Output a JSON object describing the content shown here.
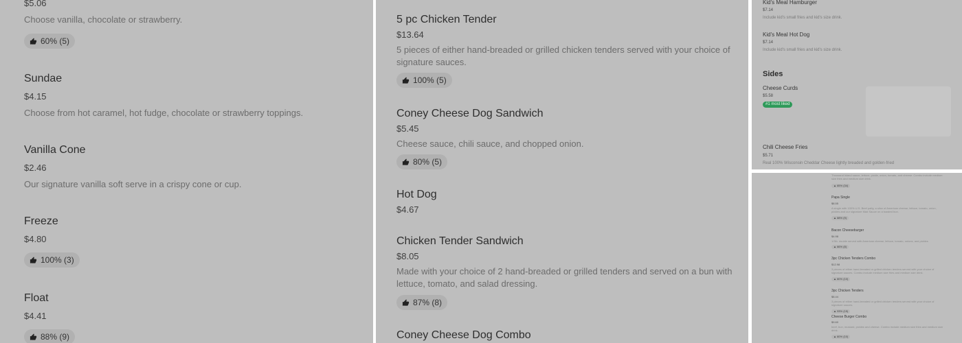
{
  "col1": {
    "top": {
      "price": "$5.06",
      "desc": "Choose vanilla, chocolate or strawberry.",
      "rating": "60% (5)"
    },
    "sundae": {
      "name": "Sundae",
      "price": "$4.15",
      "desc": "Choose from hot caramel, hot fudge, chocolate or strawberry toppings."
    },
    "cone": {
      "name": "Vanilla Cone",
      "price": "$2.46",
      "desc": "Our signature vanilla soft serve in a crispy cone or cup."
    },
    "freeze": {
      "name": "Freeze",
      "price": "$4.80",
      "rating": "100% (3)"
    },
    "float": {
      "name": "Float",
      "price": "$4.41",
      "rating": "88% (9)"
    }
  },
  "col2": {
    "tender5": {
      "name": "5 pc Chicken Tender",
      "price": "$13.64",
      "desc1": "5 pieces of either hand-breaded or grilled chicken tenders served with your choice of",
      "desc2": "signature sauces.",
      "rating": "100% (5)"
    },
    "coney": {
      "name": "Coney Cheese Dog Sandwich",
      "price": "$5.45",
      "desc": "Cheese sauce, chili sauce, and chopped onion.",
      "rating": "80% (5)"
    },
    "hotdog": {
      "name": "Hot Dog",
      "price": "$4.67"
    },
    "tendersand": {
      "name": "Chicken Tender Sandwich",
      "price": "$8.05",
      "desc1": "Made with your choice of 2 hand-breaded or grilled tenders and served on a bun with",
      "desc2": "lettuce, tomato, and salad dressing.",
      "rating": "87% (8)"
    },
    "coneycombo": {
      "name": "Coney Cheese Dog Combo"
    }
  },
  "col3": {
    "kidsburger": {
      "name": "Kid's Meal Hamburger",
      "price": "$7.14",
      "desc": "Include kid's small fries and kid's size drink."
    },
    "kidshotdog": {
      "name": "Kid's Meal Hot Dog",
      "price": "$7.14",
      "desc": "Include kid's small fries and kid's size drink."
    },
    "sides_heading": "Sides",
    "curds": {
      "name": "Cheese Curds",
      "price": "$5.58",
      "tag": "#1 most liked"
    },
    "fries": {
      "name": "Chili Cheese Fries",
      "price": "$5.71",
      "desc": "Real 100% Wisconsin Cheddar Cheese lightly breaded and golden-fried"
    }
  },
  "col4": {
    "frag": {
      "desc": "Thousand Island sauce, lettuce, pickle, onion, tomato, and cheese. Combo include medium",
      "desc2": "size fries and medium size drink.",
      "rating": "85% (34)"
    },
    "papa": {
      "name": "Papa Single",
      "price": "$8.55",
      "desc": "A single with 100% U.S. Beef patty, a slice of American cheese, lettuce, tomato, onion,",
      "desc2": "pickles and our signature Mad Sauce on a toasted bun.",
      "rating": "88% (9)"
    },
    "bacon": {
      "name": "Bacon Cheeseburger",
      "price": "$4.98",
      "desc": "1/3lb. double served with American cheese, lettuce, tomato, onions, and pickles",
      "rating": "86% (8)"
    },
    "combo3": {
      "name": "3pc Chicken Tenders Combo",
      "price": "$12.98",
      "desc": "3 pieces of either hand-breaded or grilled chicken tenders served with your choice of",
      "desc2": "signature sauces. Combo include medium size fries and medium size drink.",
      "rating": "80% (10)"
    },
    "tenders3": {
      "name": "3pc Chicken Tenders",
      "price": "$8.44",
      "desc": "3 pieces of either hand-breaded or grilled chicken tenders served with your choice of",
      "desc2": "signature sauces.",
      "rating": "93% (15)"
    },
    "cbcombo": {
      "name": "Cheese Burger Combo",
      "price": "$9.60",
      "desc": "beef, bun, mustard, pickles and cheese. Combo include medium size fries and medium size",
      "desc2": "drink.",
      "rating": "80% (10)"
    }
  }
}
